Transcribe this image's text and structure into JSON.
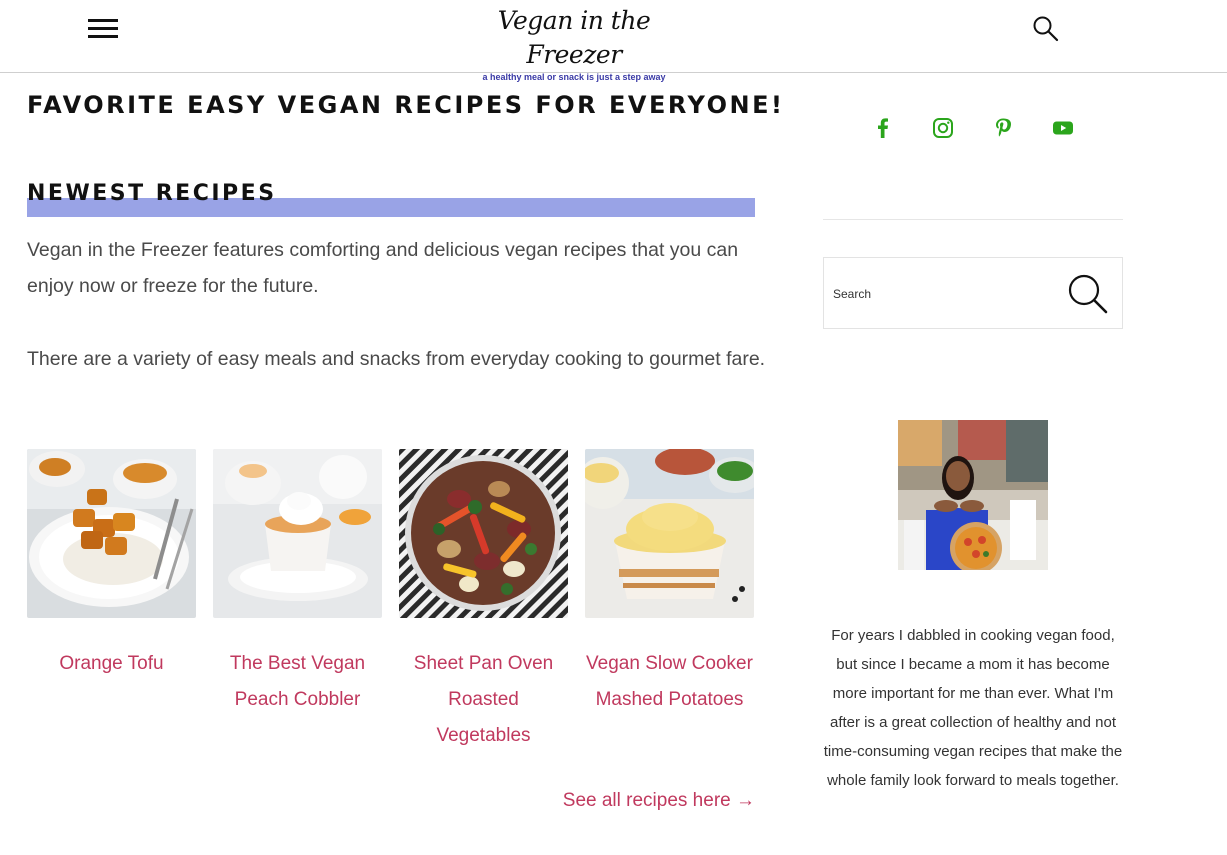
{
  "header": {
    "logo_title": "Vegan in the Freezer",
    "logo_tagline": "a healthy meal or snack is just a step away",
    "menu_icon": "hamburger-menu-icon",
    "search_icon": "search-icon"
  },
  "main": {
    "page_title": "FAVORITE EASY VEGAN RECIPES FOR EVERYONE!",
    "section_title": "NEWEST RECIPES",
    "intro_paragraphs": [
      "Vegan in the Freezer features comforting and delicious vegan recipes that you can enjoy now or freeze for the future.",
      "There are a variety of easy meals and snacks from everyday cooking to gourmet fare."
    ],
    "recipes": [
      {
        "title": "Orange Tofu"
      },
      {
        "title": "The Best Vegan Peach Cobbler"
      },
      {
        "title": "Sheet Pan Oven Roasted Vegetables"
      },
      {
        "title": "Vegan Slow Cooker Mashed Potatoes"
      }
    ],
    "see_all": "See all recipes here →"
  },
  "sidebar": {
    "social": [
      "facebook-icon",
      "instagram-icon",
      "pinterest-icon",
      "youtube-icon"
    ],
    "search_placeholder": "Search",
    "bio": "For years I dabbled in cooking vegan food, but since I became a mom it has become more important for me than ever. What I'm after is a great collection of healthy and not time-consuming vegan recipes that make the whole family look forward to meals together."
  },
  "colors": {
    "accent": "#c0395e",
    "section_bar": "#99a3e6",
    "social_green": "#2ba51c",
    "tagline_blue": "#3a3aa6"
  }
}
